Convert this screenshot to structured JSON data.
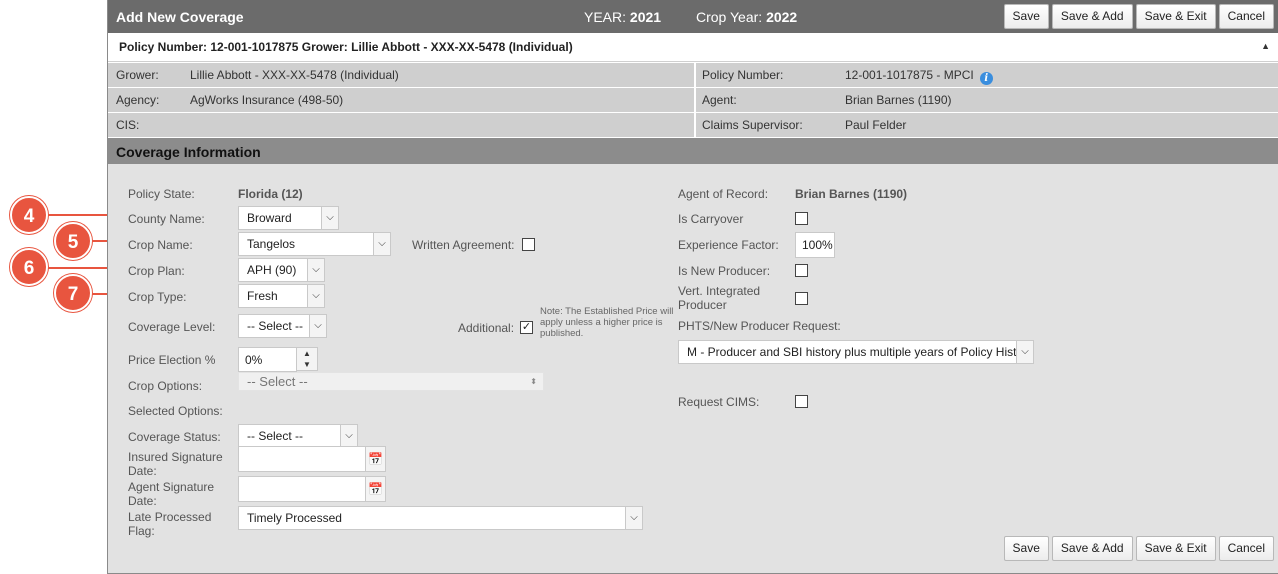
{
  "markers": [
    {
      "number": "4"
    },
    {
      "number": "5"
    },
    {
      "number": "6"
    },
    {
      "number": "7"
    }
  ],
  "header": {
    "title": "Add New Coverage",
    "year_label": "YEAR:",
    "year_value": "2021",
    "crop_year_label": "Crop Year:",
    "crop_year_value": "2022",
    "buttons": {
      "save": "Save",
      "save_add": "Save & Add",
      "save_exit": "Save & Exit",
      "cancel": "Cancel"
    }
  },
  "policy_bar": {
    "text": "Policy Number: 12-001-1017875 Grower: Lillie Abbott - XXX-XX-5478 (Individual)",
    "collapse_icon": "▲"
  },
  "info": {
    "grower_label": "Grower:",
    "grower_value": "Lillie Abbott - XXX-XX-5478 (Individual)",
    "agency_label": "Agency:",
    "agency_value": "AgWorks Insurance (498-50)",
    "cis_label": "CIS:",
    "policy_label": "Policy Number:",
    "policy_value": "12-001-1017875 - MPCI",
    "agent_label": "Agent:",
    "agent_value": "Brian Barnes (1190)",
    "claims_label": "Claims Supervisor:",
    "claims_value": "Paul Felder"
  },
  "section": {
    "title": "Coverage Information"
  },
  "form": {
    "policy_state_label": "Policy State:",
    "policy_state_value": "Florida (12)",
    "county_label": "County Name:",
    "county_value": "Broward",
    "crop_name_label": "Crop Name:",
    "crop_name_value": "Tangelos",
    "written_agreement_label": "Written Agreement:",
    "crop_plan_label": "Crop Plan:",
    "crop_plan_value": "APH (90)",
    "crop_type_label": "Crop Type:",
    "crop_type_value": "Fresh",
    "coverage_level_label": "Coverage Level:",
    "coverage_level_value": "-- Select --",
    "additional_label": "Additional:",
    "additional_note": "Note: The Established Price will apply unless a higher price is published.",
    "price_election_label": "Price Election %",
    "price_election_value": "0%",
    "crop_options_label": "Crop Options:",
    "crop_options_value": "-- Select --",
    "selected_options_label": "Selected Options:",
    "coverage_status_label": "Coverage Status:",
    "coverage_status_value": "-- Select --",
    "insured_sig_label": "Insured Signature Date:",
    "agent_sig_label": "Agent Signature Date:",
    "late_flag_label": "Late Processed Flag:",
    "late_flag_value": "Timely Processed",
    "agent_of_record_label": "Agent of Record:",
    "agent_of_record_value": "Brian Barnes (1190)",
    "carryover_label": "Is Carryover",
    "experience_label": "Experience Factor:",
    "experience_value": "100%",
    "new_producer_label": "Is New Producer:",
    "vert_label": "Vert. Integrated Producer",
    "phts_label": "PHTS/New Producer Request:",
    "phts_value": "M - Producer and SBI history plus multiple years of Policy History",
    "cims_label": "Request CIMS:"
  }
}
